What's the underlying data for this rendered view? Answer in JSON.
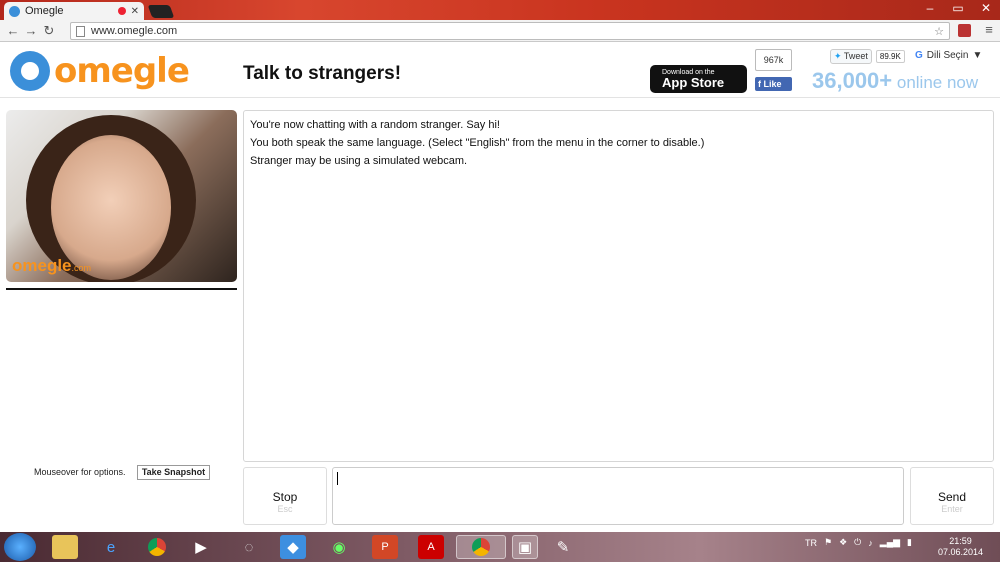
{
  "browser": {
    "tab_title": "Omegle",
    "url": "www.omegle.com"
  },
  "header": {
    "logo_text": "omegle",
    "tagline": "Talk to strangers!",
    "appstore_line1": "Download on the",
    "appstore_line2": "App Store",
    "fb_count": "967k",
    "fb_like": "Like",
    "tweet_label": "Tweet",
    "tweet_count": "89.9K",
    "language_label": "Dili Seçin",
    "online_count": "36,000+",
    "online_suffix": "online now"
  },
  "video": {
    "watermark": "omegle",
    "watermark_suffix": ".com",
    "mouseover_text": "Mouseover for options.",
    "snapshot_button": "Take Snapshot"
  },
  "chat": {
    "messages": [
      "You're now chatting with a random stranger. Say hi!",
      "You both speak the same language. (Select \"English\" from the menu in the corner to disable.)",
      "Stranger may be using a simulated webcam."
    ],
    "stop_label": "Stop",
    "stop_key": "Esc",
    "send_label": "Send",
    "send_key": "Enter",
    "message_value": ""
  },
  "taskbar": {
    "lang": "TR",
    "time": "21:59",
    "date": "07.06.2014"
  },
  "colors": {
    "brand_orange": "#f7931e",
    "brand_blue": "#3b8fd9",
    "online_blue": "#9bc7ec"
  }
}
